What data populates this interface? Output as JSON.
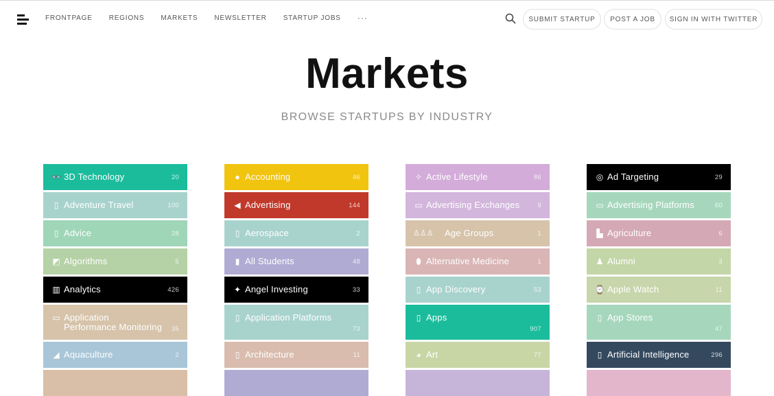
{
  "nav": {
    "items": [
      "FRONTPAGE",
      "REGIONS",
      "MARKETS",
      "NEWSLETTER",
      "STARTUP JOBS"
    ],
    "more": "···",
    "search_icon": "search-icon",
    "buttons": {
      "submit": "SUBMIT STARTUP",
      "post_job": "POST A JOB",
      "sign_in": "SIGN IN WITH TWITTER"
    }
  },
  "header": {
    "title": "Markets",
    "subtitle": "BROWSE STARTUPS BY INDUSTRY"
  },
  "markets": {
    "columns": [
      [
        {
          "name": "3D Technology",
          "count": "20",
          "color": "#1abc9c",
          "icon": "glasses-icon",
          "glyph": "👓"
        },
        {
          "name": "Adventure Travel",
          "count": "100",
          "color": "#a8d3cd",
          "icon": "placeholder-icon",
          "glyph": "▯"
        },
        {
          "name": "Advice",
          "count": "28",
          "color": "#9fd6b8",
          "icon": "placeholder-icon",
          "glyph": "▯"
        },
        {
          "name": "Algorithms",
          "count": "5",
          "color": "#b5d1a6",
          "icon": "chart-icon",
          "glyph": "◩"
        },
        {
          "name": "Analytics",
          "count": "426",
          "color": "#000000",
          "icon": "bar-chart-icon",
          "glyph": "▥"
        },
        {
          "name": "Application Performance Monitoring",
          "count": "35",
          "color": "#d6c3aa",
          "icon": "monitor-icon",
          "glyph": "▭"
        },
        {
          "name": "Aquaculture",
          "count": "2",
          "color": "#a9c6d8",
          "icon": "wave-icon",
          "glyph": "◢"
        },
        {
          "name": "",
          "count": "",
          "color": "#d9bfa8",
          "icon": "",
          "glyph": ""
        }
      ],
      [
        {
          "name": "Accounting",
          "count": "46",
          "color": "#f1c40f",
          "icon": "money-bag-icon",
          "glyph": "●"
        },
        {
          "name": "Advertising",
          "count": "144",
          "color": "#c0392b",
          "icon": "megaphone-icon",
          "glyph": "◀"
        },
        {
          "name": "Aerospace",
          "count": "2",
          "color": "#a8d3cd",
          "icon": "placeholder-icon",
          "glyph": "▯"
        },
        {
          "name": "All Students",
          "count": "48",
          "color": "#b0abd3",
          "icon": "book-icon",
          "glyph": "▮"
        },
        {
          "name": "Angel Investing",
          "count": "33",
          "color": "#000000",
          "icon": "angel-icon",
          "glyph": "✦"
        },
        {
          "name": "Application Platforms",
          "count": "73",
          "color": "#a8d3cd",
          "icon": "phone-icon",
          "glyph": "▯"
        },
        {
          "name": "Architecture",
          "count": "11",
          "color": "#d9bcae",
          "icon": "placeholder-icon",
          "glyph": "▯"
        },
        {
          "name": "",
          "count": "",
          "color": "#b0abd3",
          "icon": "",
          "glyph": ""
        }
      ],
      [
        {
          "name": "Active Lifestyle",
          "count": "86",
          "color": "#d3acd9",
          "icon": "running-icon",
          "glyph": "✧"
        },
        {
          "name": "Advertising Exchanges",
          "count": "9",
          "color": "#d3b6dc",
          "icon": "monitor-icon",
          "glyph": "▭"
        },
        {
          "name": "Age Groups",
          "count": "1",
          "color": "#d6c3aa",
          "icon": "people-icon",
          "glyph": "♙♙♙"
        },
        {
          "name": "Alternative Medicine",
          "count": "1",
          "color": "#d9b5b5",
          "icon": "pill-icon",
          "glyph": "⬮"
        },
        {
          "name": "App Discovery",
          "count": "53",
          "color": "#a8d3cd",
          "icon": "phone-icon",
          "glyph": "▯"
        },
        {
          "name": "Apps",
          "count": "907",
          "color": "#1abc9c",
          "icon": "phone-icon",
          "glyph": "▯"
        },
        {
          "name": "Art",
          "count": "77",
          "color": "#c8d6a6",
          "icon": "palette-icon",
          "glyph": "◕"
        },
        {
          "name": "",
          "count": "",
          "color": "#c7b4d9",
          "icon": "",
          "glyph": ""
        }
      ],
      [
        {
          "name": "Ad Targeting",
          "count": "29",
          "color": "#000000",
          "icon": "target-icon",
          "glyph": "◎"
        },
        {
          "name": "Advertising Platforms",
          "count": "60",
          "color": "#a6d7bd",
          "icon": "monitor-icon",
          "glyph": "▭"
        },
        {
          "name": "Agriculture",
          "count": "6",
          "color": "#d4a9b5",
          "icon": "tractor-icon",
          "glyph": "▙"
        },
        {
          "name": "Alumni",
          "count": "3",
          "color": "#c3d6a8",
          "icon": "alumni-icon",
          "glyph": "♟"
        },
        {
          "name": "Apple Watch",
          "count": "11",
          "color": "#c7d6ab",
          "icon": "watch-icon",
          "glyph": "⌚"
        },
        {
          "name": "App Stores",
          "count": "47",
          "color": "#a6d7bd",
          "icon": "phone-icon",
          "glyph": "▯"
        },
        {
          "name": "Artificial Intelligence",
          "count": "296",
          "color": "#34495e",
          "icon": "phone-icon",
          "glyph": "▯"
        },
        {
          "name": "",
          "count": "",
          "color": "#e3b6cc",
          "icon": "",
          "glyph": ""
        }
      ]
    ]
  }
}
